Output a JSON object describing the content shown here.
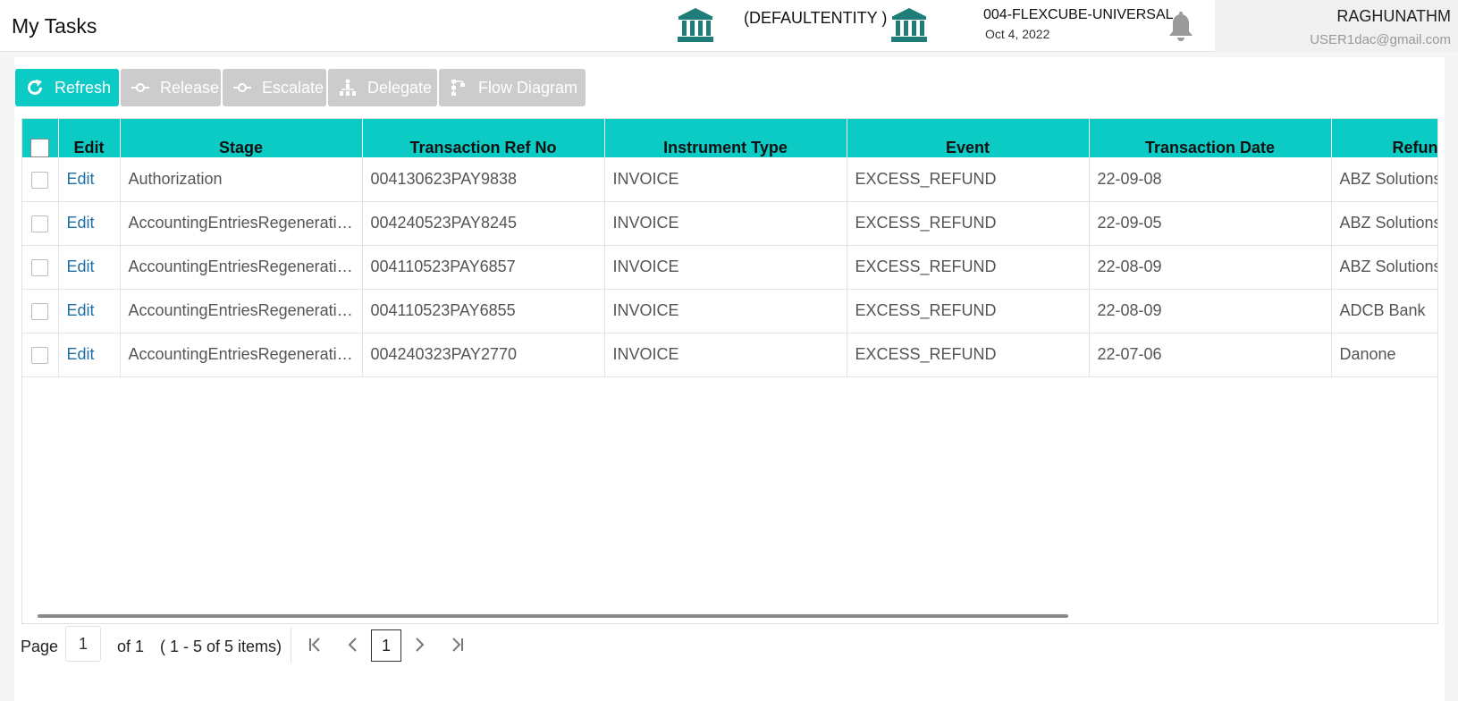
{
  "header": {
    "title": "My Tasks",
    "entity": "(DEFAULTENTITY )",
    "branch_name": "004-FLEXCUBE-UNIVERSAL...",
    "branch_date": "Oct 4, 2022",
    "user_name": "RAGHUNATHM",
    "user_email": "USER1dac@gmail.com"
  },
  "toolbar": {
    "refresh": "Refresh",
    "release": "Release",
    "escalate": "Escalate",
    "delegate": "Delegate",
    "flow_diagram": "Flow Diagram"
  },
  "table": {
    "columns": [
      "Edit",
      "Stage",
      "Transaction Ref No",
      "Instrument Type",
      "Event",
      "Transaction Date",
      "Refund"
    ],
    "rows": [
      {
        "edit": "Edit",
        "stage": "Authorization",
        "ref": "004130623PAY9838",
        "instrument": "INVOICE",
        "event": "EXCESS_REFUND",
        "date": "22-09-08",
        "refund": "ABZ Solutions"
      },
      {
        "edit": "Edit",
        "stage": "AccountingEntriesRegeneration",
        "ref": "004240523PAY8245",
        "instrument": "INVOICE",
        "event": "EXCESS_REFUND",
        "date": "22-09-05",
        "refund": "ABZ Solutions"
      },
      {
        "edit": "Edit",
        "stage": "AccountingEntriesRegeneration",
        "ref": "004110523PAY6857",
        "instrument": "INVOICE",
        "event": "EXCESS_REFUND",
        "date": "22-08-09",
        "refund": "ABZ Solutions"
      },
      {
        "edit": "Edit",
        "stage": "AccountingEntriesRegeneration",
        "ref": "004110523PAY6855",
        "instrument": "INVOICE",
        "event": "EXCESS_REFUND",
        "date": "22-08-09",
        "refund": "ADCB Bank"
      },
      {
        "edit": "Edit",
        "stage": "AccountingEntriesRegeneration",
        "ref": "004240323PAY2770",
        "instrument": "INVOICE",
        "event": "EXCESS_REFUND",
        "date": "22-07-06",
        "refund": "Danone"
      }
    ]
  },
  "pagination": {
    "page_label": "Page",
    "page_value": "1",
    "of_label": "of 1",
    "items_label": "( 1 - 5 of 5 items)",
    "current_page": "1"
  },
  "colors": {
    "accent": "#0ccbc5",
    "bank_icon": "#1e7d78",
    "link": "#1d6fa5",
    "disabled_button": "#cccccc"
  },
  "icons": {
    "entity": "bank-icon",
    "branch": "bank-icon",
    "notifications": "bell-icon",
    "refresh": "refresh-icon",
    "release": "release-icon",
    "escalate": "escalate-icon",
    "delegate": "delegate-icon",
    "flow_diagram": "flow-diagram-icon"
  }
}
